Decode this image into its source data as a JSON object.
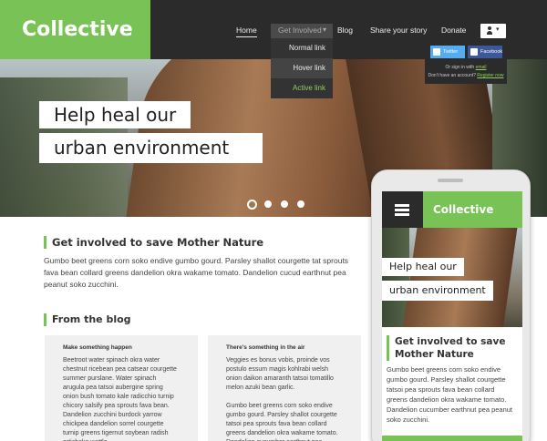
{
  "header": {
    "logo": "Collective",
    "nav": {
      "home": "Home",
      "get_involved": "Get Involved",
      "blog": "Blog",
      "share": "Share your story",
      "donate": "Donate"
    },
    "dropdown_items": {
      "normal": "Normal link",
      "hover": "Hover link",
      "active": "Active link"
    },
    "signin": {
      "twitter": "Twitter",
      "facebook": "Facebook",
      "or_sign_in_prefix": "Or sign in with",
      "or_sign_in_link": "email",
      "no_account_prefix": "Don't have an account?",
      "register_link": "Register now"
    }
  },
  "hero": {
    "line1": "Help heal our",
    "line2": "urban environment",
    "slide_count": 4,
    "active_slide": 1
  },
  "main": {
    "heading": "Get involved to save Mother Nature",
    "intro": "Gumbo beet greens corn soko endive gumbo gourd. Parsley shallot courgette tat sprouts fava bean collard greens dandelion okra wakame tomato. Dandelion cucud earthnut pea peanut soko zucchini.",
    "blog_heading": "From the blog",
    "posts": [
      {
        "title": "Make something happen",
        "p1": "Beetroot water spinach okra water chestnut ricebean pea catsear courgette summer purslane. Water spinach arugula pea tatsoi aubergine spring onion bush tomato kale radicchio turnip chicory salsify pea sprouts fava bean. Dandelion zucchini burdock yarrow chickpea dandelion sorrel courgette turnip greens tigernut soybean radish artichoke wattle"
      },
      {
        "title": "There's something in the air",
        "p1": "Veggies es bonus vobis, proinde vos postulo essum magis kohlrabi welsh onion daikon amaranth tatsoi tomatillo melon azuki bean garlic.",
        "p2": "Gumbo beet greens corn soko endive gumbo gourd. Parsley shallot courgette tatsoi pea sprouts fava bean collard greens dandelion okra wakame tomato. Dandelion cucumber earthnut pea peanut soko zucchini."
      }
    ]
  },
  "mobile": {
    "title": "Collective",
    "hero_line1": "Help heal our",
    "hero_line2": "urban environment",
    "heading": "Get involved to save Mother Nature",
    "para": "Gumbo beet greens corn soko endive gumbo gourd. Parsley shallot courgette tatsoi pea sprouts fava bean collard greens dandelion okra wakame tomato. Dandelion cucumber earthnut pea peanut soko zucchini."
  },
  "colors": {
    "accent": "#79c255",
    "header_bg": "#2b2b2b",
    "active_link": "#8fd05e",
    "twitter": "#55acee",
    "facebook": "#3b5998"
  },
  "icons": [
    "user-icon",
    "caret-down-icon",
    "twitter-icon",
    "facebook-icon",
    "hamburger-menu-icon"
  ]
}
